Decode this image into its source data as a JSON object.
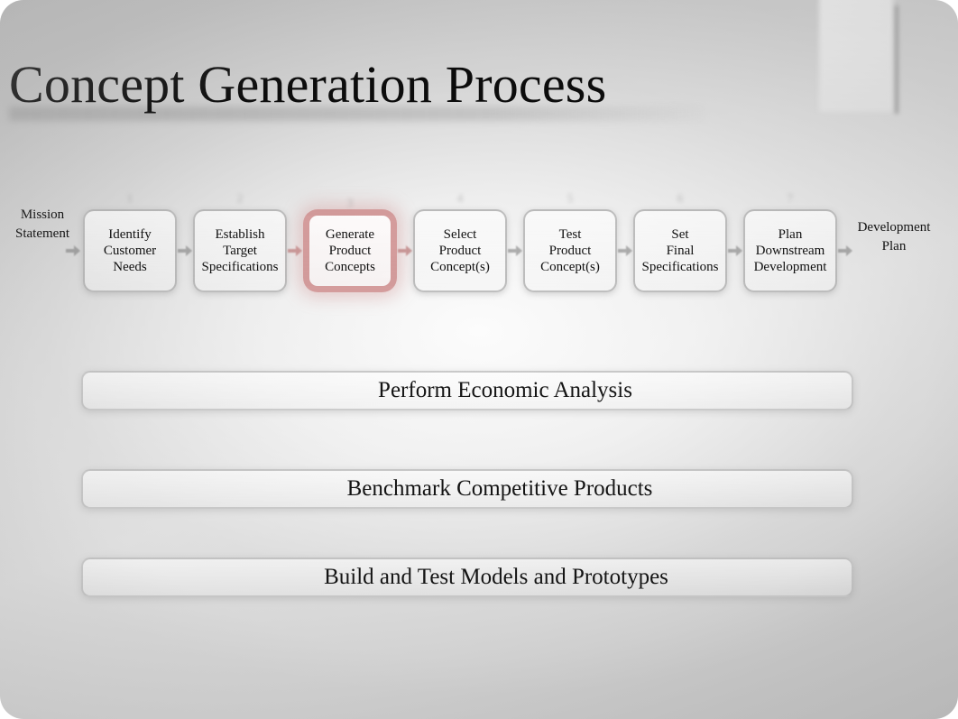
{
  "slide": {
    "title": "Concept Generation Process",
    "background_color": "#c9c9c9",
    "accent_color": "#c88282"
  },
  "flow": {
    "start_label": "Mission\nStatement",
    "end_label": "Development\nPlan",
    "highlight_index": 2,
    "stages": [
      {
        "label": "Identify\nCustomer\nNeeds",
        "ghost": "1",
        "highlight": false
      },
      {
        "label": "Establish\nTarget\nSpecifications",
        "ghost": "2",
        "highlight": false
      },
      {
        "label": "Generate\nProduct\nConcepts",
        "ghost": "3",
        "highlight": true
      },
      {
        "label": "Select\nProduct\nConcept(s)",
        "ghost": "4",
        "highlight": false
      },
      {
        "label": "Test\nProduct\nConcept(s)",
        "ghost": "5",
        "highlight": false
      },
      {
        "label": "Set\nFinal\nSpecifications",
        "ghost": "6",
        "highlight": false
      },
      {
        "label": "Plan\nDownstream\nDevelopment",
        "ghost": "7",
        "highlight": false
      }
    ]
  },
  "activities": [
    {
      "label": "Perform Economic Analysis"
    },
    {
      "label": "Benchmark Competitive Products"
    },
    {
      "label": "Build and Test Models and Prototypes"
    }
  ]
}
